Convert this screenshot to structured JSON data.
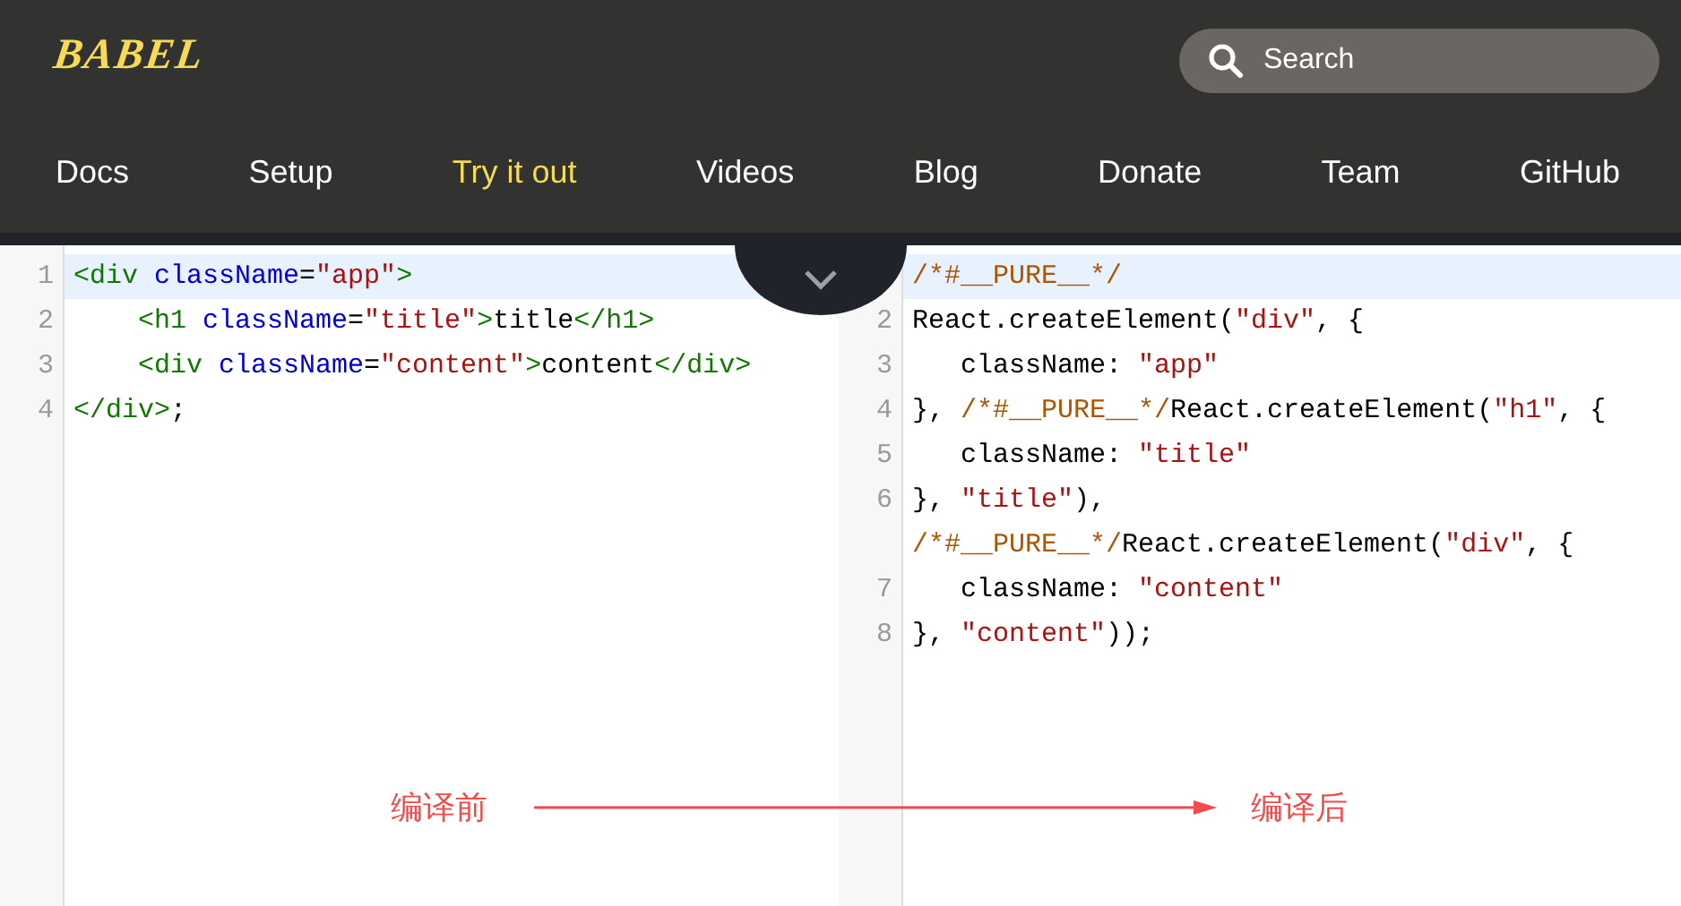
{
  "header": {
    "logo": "BABEL",
    "search": {
      "placeholder": "Search"
    }
  },
  "nav": [
    {
      "label": "Docs",
      "selected": false
    },
    {
      "label": "Setup",
      "selected": false
    },
    {
      "label": "Try it out",
      "selected": true
    },
    {
      "label": "Videos",
      "selected": false
    },
    {
      "label": "Blog",
      "selected": false
    },
    {
      "label": "Donate",
      "selected": false
    },
    {
      "label": "Team",
      "selected": false
    },
    {
      "label": "GitHub",
      "selected": false
    }
  ],
  "input_editor": {
    "lines": [
      {
        "number": "1",
        "active": true,
        "tokens": [
          {
            "kind": "tag",
            "text": "<div"
          },
          {
            "kind": "attr",
            "text": " className"
          },
          {
            "kind": "plain",
            "text": "="
          },
          {
            "kind": "string",
            "text": "\"app\""
          },
          {
            "kind": "tag",
            "text": ">"
          }
        ]
      },
      {
        "number": "2",
        "active": false,
        "tokens": [
          {
            "kind": "tag",
            "text": "    <h1"
          },
          {
            "kind": "attr",
            "text": " className"
          },
          {
            "kind": "plain",
            "text": "="
          },
          {
            "kind": "string",
            "text": "\"title\""
          },
          {
            "kind": "tag",
            "text": ">"
          },
          {
            "kind": "plain",
            "text": "title"
          },
          {
            "kind": "tag",
            "text": "</h1>"
          }
        ]
      },
      {
        "number": "3",
        "active": false,
        "tokens": [
          {
            "kind": "tag",
            "text": "    <div"
          },
          {
            "kind": "attr",
            "text": " className"
          },
          {
            "kind": "plain",
            "text": "="
          },
          {
            "kind": "string",
            "text": "\"content\""
          },
          {
            "kind": "tag",
            "text": ">"
          },
          {
            "kind": "plain",
            "text": "content"
          },
          {
            "kind": "tag",
            "text": "</div>"
          }
        ]
      },
      {
        "number": "4",
        "active": false,
        "tokens": [
          {
            "kind": "tag",
            "text": "</div>"
          },
          {
            "kind": "plain",
            "text": ";"
          }
        ]
      }
    ]
  },
  "output_editor": {
    "lines": [
      {
        "active": true,
        "tokens": [
          {
            "kind": "comment",
            "text": "/*#__PURE__*/"
          }
        ]
      },
      {
        "number": "2",
        "active": false,
        "tokens": [
          {
            "kind": "plain",
            "text": "React.createElement("
          },
          {
            "kind": "string",
            "text": "\"div\""
          },
          {
            "kind": "plain",
            "text": ", {"
          }
        ]
      },
      {
        "number": "3",
        "active": false,
        "tokens": [
          {
            "kind": "plain",
            "text": "   className: "
          },
          {
            "kind": "string",
            "text": "\"app\""
          }
        ]
      },
      {
        "number": "4",
        "active": false,
        "tokens": [
          {
            "kind": "plain",
            "text": "}, "
          },
          {
            "kind": "comment",
            "text": "/*#__PURE__*/"
          },
          {
            "kind": "plain",
            "text": "React.createElement("
          },
          {
            "kind": "string",
            "text": "\"h1\""
          },
          {
            "kind": "plain",
            "text": ", {"
          }
        ]
      },
      {
        "number": "5",
        "active": false,
        "tokens": [
          {
            "kind": "plain",
            "text": "   className: "
          },
          {
            "kind": "string",
            "text": "\"title\""
          }
        ]
      },
      {
        "number": "6",
        "active": false,
        "tokens": [
          {
            "kind": "plain",
            "text": "}, "
          },
          {
            "kind": "string",
            "text": "\"title\""
          },
          {
            "kind": "plain",
            "text": "),"
          }
        ]
      },
      {
        "active": false,
        "tokens": [
          {
            "kind": "comment",
            "text": "/*#__PURE__*/"
          },
          {
            "kind": "plain",
            "text": "React.createElement("
          },
          {
            "kind": "string",
            "text": "\"div\""
          },
          {
            "kind": "plain",
            "text": ", {"
          }
        ]
      },
      {
        "number": "7",
        "active": false,
        "tokens": [
          {
            "kind": "plain",
            "text": "   className: "
          },
          {
            "kind": "string",
            "text": "\"content\""
          }
        ]
      },
      {
        "number": "8",
        "active": false,
        "tokens": [
          {
            "kind": "plain",
            "text": "}, "
          },
          {
            "kind": "string",
            "text": "\"content\""
          },
          {
            "kind": "plain",
            "text": "));"
          }
        ]
      }
    ]
  },
  "annotation": {
    "before": "编译前",
    "after": "编译后"
  }
}
